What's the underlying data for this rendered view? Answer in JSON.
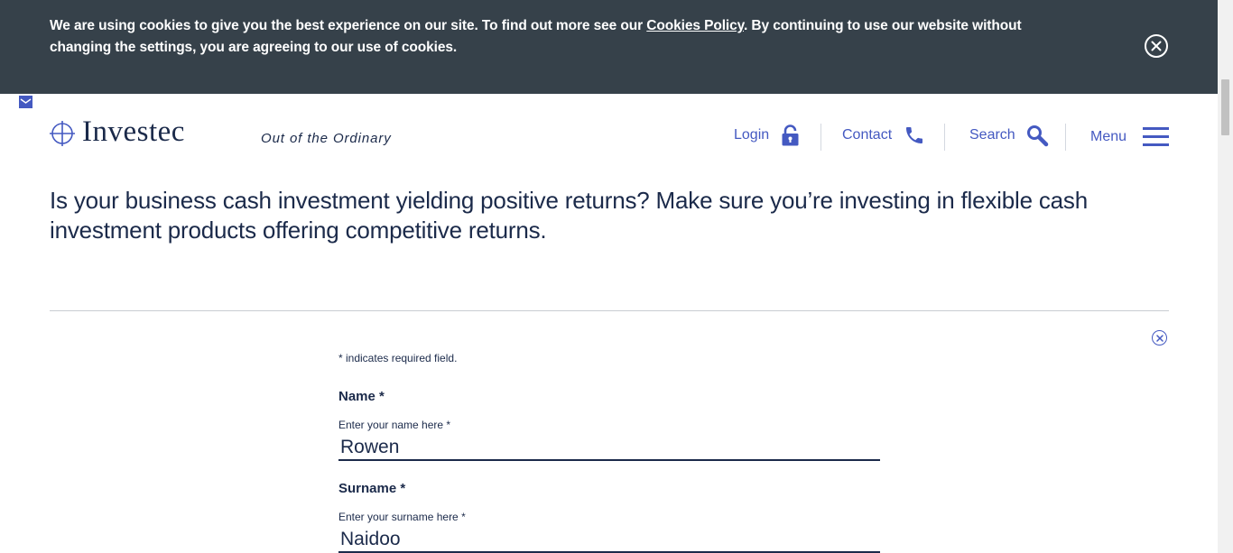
{
  "cookie_banner": {
    "text_before": "We are using cookies to give you the best experience on our site. To find out more see our ",
    "link": "Cookies Policy",
    "text_after": ". By continuing to use our website without changing the settings, you are agreeing to our use of cookies.",
    "close_icon": "close-circle-icon"
  },
  "header": {
    "brand": "Investec",
    "tagline": "Out of the Ordinary",
    "nav": [
      {
        "label": "Login",
        "icon": "lock-icon"
      },
      {
        "label": "Contact",
        "icon": "phone-icon"
      },
      {
        "label": "Search",
        "icon": "search-icon"
      },
      {
        "label": "Menu",
        "icon": "hamburger-icon"
      }
    ],
    "accent_color": "#4459c1",
    "navy_color": "#1b2a4a",
    "banner_color": "#36414a"
  },
  "intro": {
    "text": "Is your business cash investment yielding positive returns? Make sure you’re investing in flexible cash investment products offering competitive returns."
  },
  "form": {
    "required_note": "* indicates required field.",
    "name": {
      "title": "Name *",
      "label": "Enter your name here *",
      "value": "Rowen"
    },
    "surname": {
      "title": "Surname *",
      "label": "Enter your surname here *",
      "value": "Naidoo"
    }
  }
}
